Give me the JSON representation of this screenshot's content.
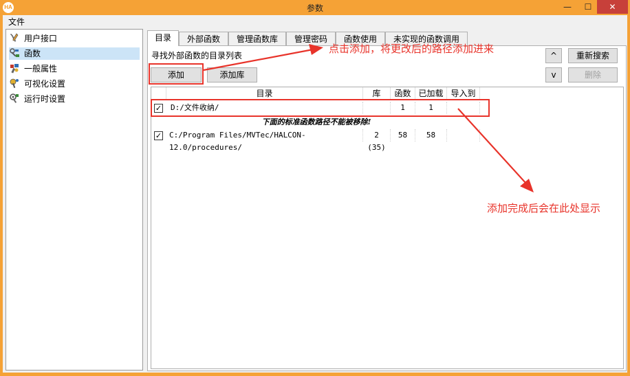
{
  "window": {
    "logo": "HA",
    "title": "参数",
    "minimize": "—",
    "maximize": "☐",
    "close": "✕"
  },
  "menu": {
    "file": "文件"
  },
  "tree": {
    "items": [
      {
        "label": "用户接口",
        "icon": "wrench-pencil-icon"
      },
      {
        "label": "函数",
        "icon": "function-tools-icon",
        "selected": true
      },
      {
        "label": "一般属性",
        "icon": "general-properties-icon"
      },
      {
        "label": "可视化设置",
        "icon": "visualization-icon"
      },
      {
        "label": "运行时设置",
        "icon": "runtime-settings-icon"
      }
    ]
  },
  "tabs": [
    {
      "label": "目录",
      "active": true
    },
    {
      "label": "外部函数"
    },
    {
      "label": "管理函数库"
    },
    {
      "label": "管理密码"
    },
    {
      "label": "函数使用"
    },
    {
      "label": "未实现的函数调用"
    }
  ],
  "directory_panel": {
    "section_label": "寻找外部函数的目录列表",
    "add_button": "添加",
    "add_library_button": "添加库",
    "up_button": "^",
    "down_button": "v",
    "rescan_button": "重新搜索",
    "delete_button": "删除",
    "columns": [
      "目录",
      "库",
      "函数",
      "已加载",
      "导入到"
    ],
    "user_rows": [
      {
        "checked": true,
        "path": "D:/文件收纳/",
        "library": "",
        "functions": "1",
        "loaded": "1",
        "imported_to": ""
      }
    ],
    "notice": "下面的标准函数路径不能被移除!",
    "standard_rows": [
      {
        "checked": true,
        "path": "C:/Program Files/MVTec/HALCON-12.0/procedures/",
        "library": "2 (35)",
        "functions": "58",
        "loaded": "58",
        "imported_to": ""
      }
    ]
  },
  "annotations": {
    "add_hint": "点击添加，将更改后的路径添加进来",
    "result_hint": "添加完成后会在此处显示",
    "color": "#e8332a"
  },
  "colors": {
    "title_bar": "#f5a236",
    "selection": "#cce4f7"
  }
}
